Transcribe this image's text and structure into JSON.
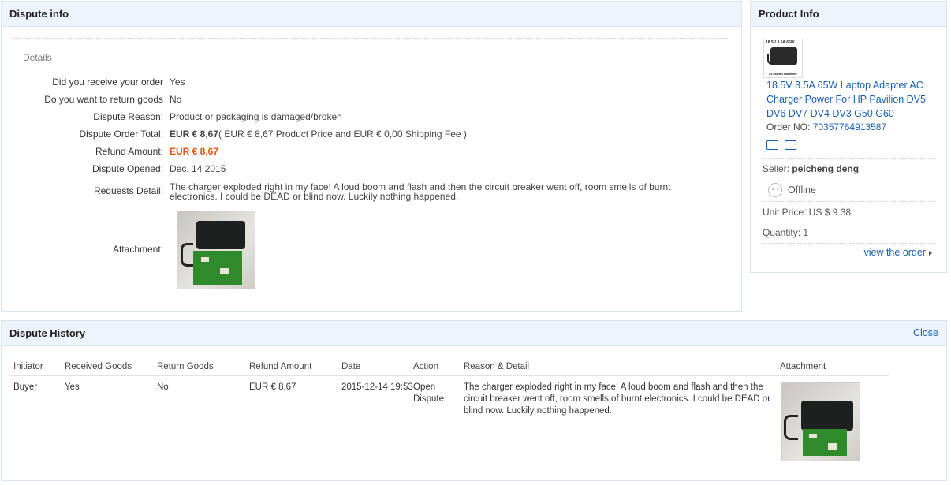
{
  "dispute_info": {
    "title": "Dispute info",
    "details_label": "Details",
    "rows": {
      "received": {
        "label": "Did you receive your order",
        "value": "Yes"
      },
      "return_goods": {
        "label": "Do you want to return goods",
        "value": "No"
      },
      "reason": {
        "label": "Dispute Reason:",
        "value": "Product or packaging is damaged/broken"
      },
      "order_total": {
        "label": "Dispute Order Total:",
        "amount": "EUR € 8,67",
        "breakdown": "( EUR € 8,67 Product Price and EUR € 0,00 Shipping Fee )"
      },
      "refund": {
        "label": "Refund Amount:",
        "value": "EUR € 8,67"
      },
      "opened": {
        "label": "Dispute Opened:",
        "value": "Dec. 14 2015"
      },
      "requests": {
        "label": "Requests Detail:",
        "value": "The charger exploded right in my face! A loud boom and flash and then the circuit breaker went off, room smells of burnt electronics. I could be DEAD or blind now. Luckily nothing happened."
      },
      "attachment": {
        "label": "Attachment:"
      }
    }
  },
  "product_info": {
    "title": "Product Info",
    "image_text_top": "18.5V 3.5A 65W",
    "image_text_bottom": "24 month warranty",
    "product_title": "18.5V 3.5A 65W Laptop Adapter AC Charger Power For HP Pavilion DV5 DV6 DV7 DV4 DV3 G50 G60",
    "order_no_label": "Order NO:",
    "order_no": "70357764913587",
    "seller_label": "Seller:",
    "seller_name": "peicheng deng",
    "status": "Offline",
    "unit_price": "Unit Price: US $ 9.38",
    "quantity": "Quantity: 1",
    "view_order": "view the order"
  },
  "dispute_history": {
    "title": "Dispute History",
    "close": "Close",
    "columns": [
      "Initiator",
      "Received Goods",
      "Return Goods",
      "Refund Amount",
      "Date",
      "Action",
      "Reason & Detail",
      "Attachment"
    ],
    "rows": [
      {
        "initiator": "Buyer",
        "received": "Yes",
        "return_goods": "No",
        "refund": "EUR € 8,67",
        "date": "2015-12-14 19:53",
        "action": "Open Dispute",
        "detail": "The charger exploded right in my face! A loud boom and flash and then the circuit breaker went off, room smells of burnt electronics. I could be DEAD or blind now. Luckily nothing happened."
      }
    ]
  }
}
